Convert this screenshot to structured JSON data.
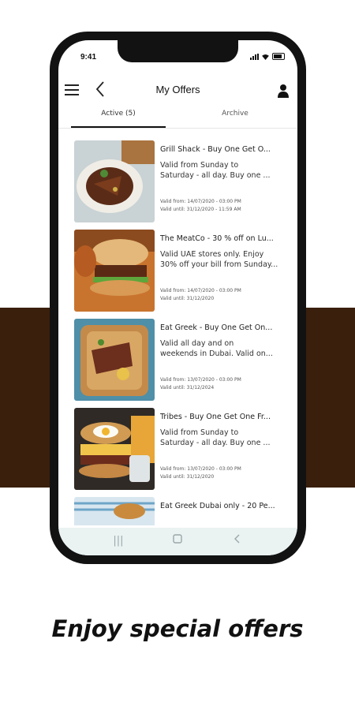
{
  "status_bar": {
    "time": "9:41"
  },
  "header": {
    "title": "My Offers"
  },
  "tabs": [
    {
      "label": "Active (5)"
    },
    {
      "label": "Archive"
    }
  ],
  "offers": [
    {
      "title": "Grill Shack - Buy One Get O...",
      "desc": [
        "Valid from Sunday to",
        "Saturday - all day. Buy one ..."
      ],
      "valid_from": "Valid from: 14/07/2020 - 03:00 PM",
      "valid_until": "Valid until: 31/12/2020 - 11:59 AM"
    },
    {
      "title": "The MeatCo - 30 % off on Lu...",
      "desc": [
        "Valid UAE stores only. Enjoy",
        "30% off your bill from Sunday..."
      ],
      "valid_from": "Valid from: 14/07/2020 - 03:00 PM",
      "valid_until": "Valid until: 31/12/2020"
    },
    {
      "title": "Eat Greek - Buy One Get On...",
      "desc": [
        "Valid all day and on",
        "weekends in Dubai. Valid on..."
      ],
      "valid_from": "Valid from: 13/07/2020 - 03:00 PM",
      "valid_until": "Valid until: 31/12/2024"
    },
    {
      "title": "Tribes - Buy One Get One Fr...",
      "desc": [
        "Valid from Sunday to",
        "Saturday - all day. Buy one ..."
      ],
      "valid_from": "Valid from: 13/07/2020 - 03:00 PM",
      "valid_until": "Valid until: 31/12/2020"
    },
    {
      "title": "Eat Greek Dubai only - 20 Pe...",
      "desc": [
        "",
        ""
      ],
      "valid_from": "",
      "valid_until": ""
    }
  ],
  "caption": "Enjoy special offers",
  "colors": {
    "band": "#3a1f0c",
    "phone_frame": "#121212",
    "nav_bar": "#eaf2f2"
  }
}
